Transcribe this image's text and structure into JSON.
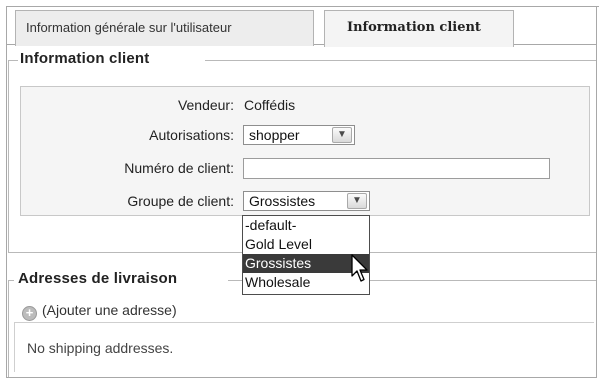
{
  "tabs": [
    {
      "label": "Information générale sur l'utilisateur",
      "active": false
    },
    {
      "label": "Information client",
      "active": true
    }
  ],
  "client_info": {
    "legend": "Information client",
    "seller_label": "Vendeur:",
    "seller_value": "Coffédis",
    "permissions_label": "Autorisations:",
    "permissions_value": "shopper",
    "customer_number_label": "Numéro de client:",
    "customer_number_value": "",
    "customer_group_label": "Groupe de client:",
    "customer_group_value": "Grossistes",
    "customer_group_options": [
      "-default-",
      "Gold Level",
      "Grossistes",
      "Wholesale"
    ],
    "highlighted_option": "Grossistes"
  },
  "shipping": {
    "legend": "Adresses de livraison",
    "add_link": "(Ajouter une adresse)",
    "empty_message": "No shipping addresses."
  },
  "icons": {
    "add": "plus-circle-icon",
    "dropdown_arrow": "chevron-down-icon",
    "cursor": "mouse-pointer-icon"
  }
}
